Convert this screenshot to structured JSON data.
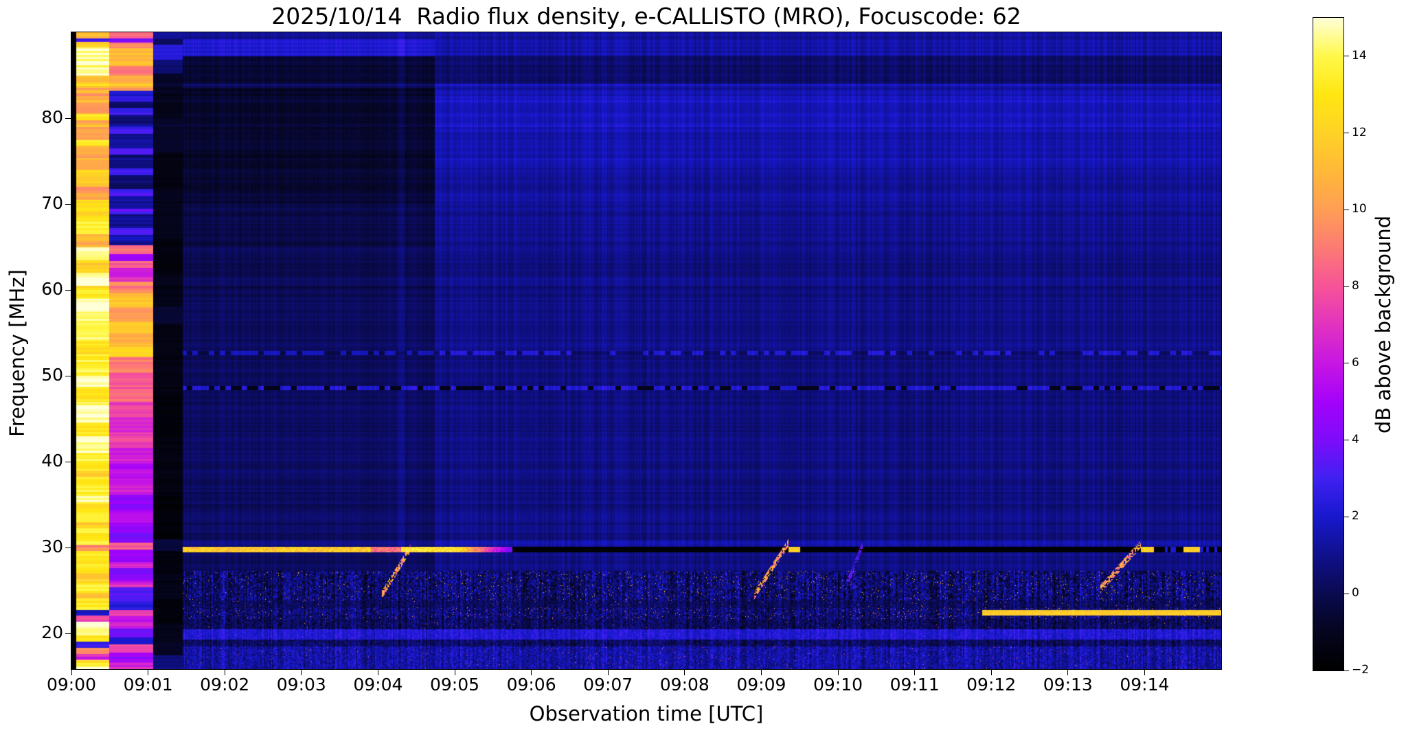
{
  "title": "2025/10/14  Radio flux density, e-CALLISTO (MRO), Focuscode: 62",
  "chart_data": {
    "type": "heatmap",
    "title": "2025/10/14  Radio flux density, e-CALLISTO (MRO), Focuscode: 62",
    "xlabel": "Observation time [UTC]",
    "ylabel": "Frequency [MHz]",
    "colorbar_label": "dB above background",
    "x_tick_labels": [
      "09:00",
      "09:01",
      "09:02",
      "09:03",
      "09:04",
      "09:05",
      "09:06",
      "09:07",
      "09:08",
      "09:09",
      "09:10",
      "09:11",
      "09:12",
      "09:13",
      "09:14"
    ],
    "x_range_minutes": [
      0,
      15
    ],
    "y_tick_values": [
      80,
      70,
      60,
      50,
      40,
      30,
      20
    ],
    "y_range_mhz": [
      15.84,
      90
    ],
    "colorbar_tick_values": [
      14,
      12,
      10,
      8,
      6,
      4,
      2,
      0,
      -2
    ],
    "colorbar_range_db": [
      -2,
      15
    ],
    "colormap": "gnuplot2-like",
    "colormap_stops": [
      [
        -2,
        "#000000"
      ],
      [
        -1,
        "#05051e"
      ],
      [
        0,
        "#0a0a50"
      ],
      [
        1,
        "#10108c"
      ],
      [
        2,
        "#1818cd"
      ],
      [
        3,
        "#4020f2"
      ],
      [
        4,
        "#7d0cfa"
      ],
      [
        5,
        "#a402fa"
      ],
      [
        6,
        "#c716e3"
      ],
      [
        7,
        "#e133bf"
      ],
      [
        8,
        "#f65398"
      ],
      [
        9,
        "#fc7a74"
      ],
      [
        10,
        "#ff9e55"
      ],
      [
        11,
        "#ffb838"
      ],
      [
        12,
        "#ffd226"
      ],
      [
        13,
        "#ffe612"
      ],
      [
        14,
        "#fff84a"
      ],
      [
        15,
        "#ffffd8"
      ]
    ],
    "features": {
      "lead_black_end_min": 0.055,
      "noise": {
        "seed": 42,
        "row_amp": 0.55,
        "col_amp": 0.5
      },
      "cal_bands": [
        {
          "t0": 0.055,
          "t1": 0.49,
          "noise": 1.4,
          "profile": [
            [
              90,
              89.3,
              11
            ],
            [
              89.3,
              88.9,
              3
            ],
            [
              88.9,
              88.3,
              12
            ],
            [
              88.3,
              85.0,
              14.8
            ],
            [
              85.0,
              83.0,
              11.5
            ],
            [
              83.0,
              80.5,
              10
            ],
            [
              80.5,
              79.8,
              12.8
            ],
            [
              79.8,
              77.5,
              10.2
            ],
            [
              77.5,
              76.8,
              13
            ],
            [
              76.8,
              74.0,
              10.5
            ],
            [
              74.0,
              72.0,
              12
            ],
            [
              72.0,
              70.5,
              10
            ],
            [
              70.5,
              68.0,
              12.5
            ],
            [
              68.0,
              66.5,
              13.5
            ],
            [
              66.5,
              65.0,
              11
            ],
            [
              65.0,
              63.5,
              14.5
            ],
            [
              63.5,
              62.0,
              12.5
            ],
            [
              62.0,
              60.5,
              15
            ],
            [
              60.5,
              59.0,
              13.5
            ],
            [
              59.0,
              57.5,
              15
            ],
            [
              57.5,
              54.0,
              14
            ],
            [
              54.0,
              52.5,
              12.2
            ],
            [
              52.5,
              50.0,
              13.8
            ],
            [
              50.0,
              48.5,
              15
            ],
            [
              48.5,
              47.0,
              13
            ],
            [
              47.0,
              44.5,
              14.8
            ],
            [
              44.5,
              43.0,
              13.2
            ],
            [
              43.0,
              41.0,
              14.6
            ],
            [
              41.0,
              39.0,
              13.4
            ],
            [
              39.0,
              38.3,
              11.5
            ],
            [
              38.3,
              36.0,
              13.6
            ],
            [
              36.0,
              35.3,
              14.8
            ],
            [
              35.3,
              33.0,
              13
            ],
            [
              33.0,
              32.3,
              11.8
            ],
            [
              32.3,
              30.4,
              13.4
            ],
            [
              30.4,
              29.6,
              9.5
            ],
            [
              29.6,
              27.0,
              13.2
            ],
            [
              27.0,
              26.3,
              11.3
            ],
            [
              26.3,
              24.8,
              13.5
            ],
            [
              24.8,
              24.1,
              11
            ],
            [
              24.1,
              22.8,
              13.3
            ],
            [
              22.8,
              22.1,
              1.5
            ],
            [
              22.1,
              21.4,
              8
            ],
            [
              21.4,
              19.8,
              14.7
            ],
            [
              19.8,
              19.1,
              13
            ],
            [
              19.1,
              18.4,
              2.5
            ],
            [
              18.4,
              17.6,
              9.5
            ],
            [
              17.6,
              16.9,
              7
            ],
            [
              16.9,
              16.3,
              13.5
            ],
            [
              16.3,
              15.0,
              14.8
            ]
          ]
        },
        {
          "t0": 0.49,
          "t1": 1.06,
          "noise": 1.0,
          "profile": [
            [
              90,
              89.3,
              8.5
            ],
            [
              89.3,
              88.8,
              4
            ],
            [
              88.8,
              88.2,
              9.5
            ],
            [
              88.2,
              86.0,
              11.2
            ],
            [
              86.0,
              85.0,
              9
            ],
            [
              85.0,
              83.2,
              10.8
            ],
            [
              83.2,
              82.0,
              2.2
            ],
            [
              82.0,
              81.2,
              0.3
            ],
            [
              81.2,
              80.4,
              2.8
            ],
            [
              80.4,
              79.0,
              0.5
            ],
            [
              79.0,
              78.2,
              3
            ],
            [
              78.2,
              76.5,
              1
            ],
            [
              76.5,
              75.8,
              3.2
            ],
            [
              75.8,
              74.2,
              0.8
            ],
            [
              74.2,
              73.4,
              2.8
            ],
            [
              73.4,
              71.8,
              0.6
            ],
            [
              71.8,
              71.0,
              3
            ],
            [
              71.0,
              69.5,
              1.2
            ],
            [
              69.5,
              68.8,
              3.4
            ],
            [
              68.8,
              67.2,
              0.9
            ],
            [
              67.2,
              66.4,
              3.2
            ],
            [
              66.4,
              65.2,
              1.5
            ],
            [
              65.2,
              64.2,
              8.5
            ],
            [
              64.2,
              63.4,
              5
            ],
            [
              63.4,
              62.6,
              8.8
            ],
            [
              62.6,
              61.0,
              6.5
            ],
            [
              61.0,
              59.6,
              9.5
            ],
            [
              59.6,
              58.0,
              11.5
            ],
            [
              58.0,
              56.4,
              9.8
            ],
            [
              56.4,
              55.0,
              11.8
            ],
            [
              55.0,
              53.4,
              10.5
            ],
            [
              53.4,
              52.2,
              12.2
            ],
            [
              52.2,
              50.4,
              9.2
            ],
            [
              50.4,
              48.8,
              8.2
            ],
            [
              48.8,
              47.0,
              8.8
            ],
            [
              47.0,
              45.2,
              7.6
            ],
            [
              45.2,
              43.4,
              6.8
            ],
            [
              43.4,
              41.6,
              7.4
            ],
            [
              41.6,
              39.8,
              6.2
            ],
            [
              39.8,
              38.0,
              5.6
            ],
            [
              38.0,
              36.2,
              6.4
            ],
            [
              36.2,
              34.4,
              4.6
            ],
            [
              34.4,
              32.6,
              5.2
            ],
            [
              32.6,
              30.6,
              4.2
            ],
            [
              30.6,
              29.8,
              8.2
            ],
            [
              29.8,
              28.4,
              4.8
            ],
            [
              28.4,
              27.6,
              6.5
            ],
            [
              27.6,
              26.2,
              4.2
            ],
            [
              26.2,
              25.4,
              6.8
            ],
            [
              25.4,
              23.6,
              3.2
            ],
            [
              23.6,
              22.8,
              2.2
            ],
            [
              22.8,
              22.0,
              7.2
            ],
            [
              22.0,
              20.6,
              6
            ],
            [
              20.6,
              19.6,
              4
            ],
            [
              19.6,
              18.8,
              2
            ],
            [
              18.8,
              17.8,
              7.5
            ],
            [
              17.8,
              16.8,
              5
            ],
            [
              16.8,
              15.0,
              6.5
            ]
          ]
        },
        {
          "t0": 1.06,
          "t1": 1.45,
          "noise": 0.3,
          "profile": [
            [
              90,
              89.2,
              1.2
            ],
            [
              89.2,
              88.6,
              0.2
            ],
            [
              88.6,
              86.8,
              2.4
            ],
            [
              86.8,
              85.2,
              0.6
            ],
            [
              85.2,
              83.0,
              -0.8
            ],
            [
              83.0,
              80.0,
              -1.2
            ],
            [
              80.0,
              76.0,
              -0.8
            ],
            [
              76.0,
              72.0,
              -1.4
            ],
            [
              72.0,
              66.0,
              -1.1
            ],
            [
              66.0,
              62.0,
              -1.5
            ],
            [
              62.0,
              58.0,
              -1.2
            ],
            [
              58.0,
              56.0,
              -0.6
            ],
            [
              56.0,
              52.0,
              -1.4
            ],
            [
              52.0,
              48.0,
              -1.3
            ],
            [
              48.0,
              42.0,
              -1.6
            ],
            [
              42.0,
              36.0,
              -1.4
            ],
            [
              36.0,
              31.0,
              -1.7
            ],
            [
              31.0,
              29.6,
              -0.4
            ],
            [
              29.6,
              27.0,
              -1.5
            ],
            [
              27.0,
              24.0,
              -1.2
            ],
            [
              24.0,
              21.0,
              -1.6
            ],
            [
              21.0,
              19.0,
              -1.1
            ],
            [
              19.0,
              17.5,
              -0.9
            ],
            [
              17.5,
              15.0,
              0.8
            ]
          ]
        }
      ],
      "bg": {
        "split_min": 4.74,
        "level_pre": 0.28,
        "level_post": 0.9,
        "bands": [
          [
            90,
            89.25,
            0.8,
            0.35
          ],
          [
            89.25,
            87.2,
            1.9,
            0.55
          ],
          [
            87.2,
            84.0,
            -0.75,
            -0.45
          ],
          [
            84.0,
            83.5,
            -0.2,
            0.5
          ],
          [
            83.5,
            78.4,
            -1.0,
            0.75
          ],
          [
            78.4,
            76.2,
            -0.9,
            0.5
          ],
          [
            76.2,
            74.3,
            -1.05,
            0.65
          ],
          [
            74.3,
            70.0,
            -0.8,
            0.35
          ],
          [
            70.0,
            65.0,
            -0.45,
            0.1
          ],
          [
            65.0,
            60.0,
            -0.15,
            0.0
          ],
          [
            60.0,
            53.0,
            -0.1,
            -0.05
          ],
          [
            53.0,
            48.85,
            0.0,
            -0.1
          ],
          [
            48.3,
            43.0,
            0.05,
            -0.1
          ],
          [
            43.0,
            37.0,
            0.1,
            -0.05
          ],
          [
            37.0,
            30.9,
            0.0,
            -0.1
          ]
        ]
      },
      "vline": {
        "t": 4.3,
        "half_w": 0.04,
        "dv": 0.7
      },
      "dash48": {
        "f_hi": 48.85,
        "f_lo": 48.32,
        "v_on": 2.3,
        "v_off": -1.2
      },
      "dash52": {
        "f_hi": 52.9,
        "f_lo": 52.45,
        "dv_on": 1.5,
        "dv_off": -0.5
      },
      "line30": {
        "f_hi": 30.12,
        "f_lo": 29.5,
        "t_on": 1.45,
        "t_bright_end": 5.75,
        "v_on": 12.3,
        "v_off": -2.1,
        "glow": [
          30.9,
          30.12,
          0.45
        ],
        "orange_segments": [
          [
            9.35,
            9.5
          ],
          [
            13.95,
            14.12
          ],
          [
            14.5,
            14.72
          ]
        ],
        "blue_dash_start": 14.15
      },
      "line22": {
        "f_hi": 22.78,
        "f_lo": 22.15,
        "t_on": 11.88,
        "v": 10.8
      },
      "noise_bands": [
        [
          27.3,
          23.9,
          -1.6,
          4.2,
          0.008,
          9.5
        ],
        [
          23.9,
          23.0,
          -1.0,
          2.4,
          0.004,
          8.0
        ],
        [
          23.0,
          21.7,
          -1.2,
          3.4,
          0.01,
          8.0
        ],
        [
          21.7,
          20.5,
          -1.3,
          3.0,
          0.002,
          7.5
        ],
        [
          20.5,
          19.3,
          1.4,
          1.6,
          0.0,
          0
        ],
        [
          19.3,
          18.5,
          -1.0,
          2.6,
          0.0,
          0
        ],
        [
          18.5,
          15.0,
          0.1,
          2.6,
          0.003,
          7.0
        ]
      ],
      "bursts": [
        {
          "t0": 4.05,
          "t1": 4.42,
          "f0": 24.6,
          "f1": 30.0,
          "v": 11.5
        },
        {
          "t0": 8.9,
          "t1": 9.35,
          "f0": 24.4,
          "f1": 30.6,
          "v": 11.5
        },
        {
          "t0": 10.12,
          "t1": 10.32,
          "f0": 26.0,
          "f1": 30.4,
          "v": 4.0
        },
        {
          "t0": 13.42,
          "t1": 13.95,
          "f0": 25.2,
          "f1": 30.5,
          "v": 11.5
        }
      ]
    }
  }
}
